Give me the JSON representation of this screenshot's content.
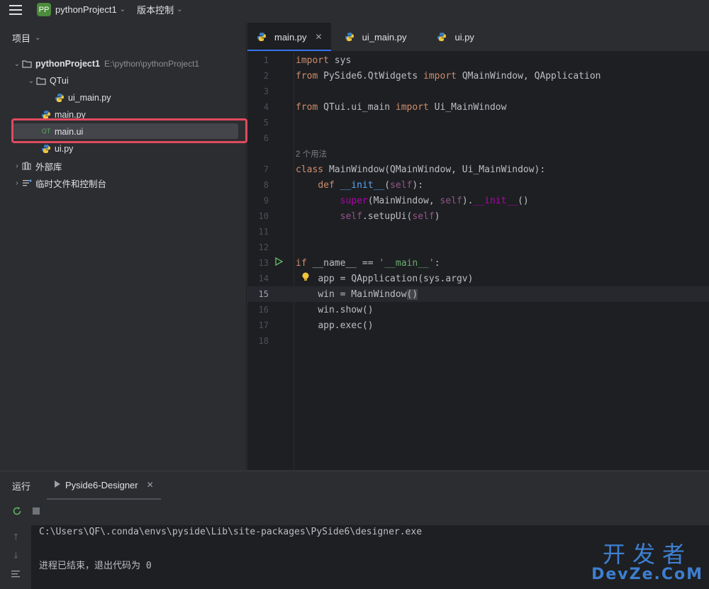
{
  "titlebar": {
    "badge": "PP",
    "project": "pythonProject1",
    "vcs": "版本控制"
  },
  "project_panel": {
    "title": "项目",
    "tree": [
      {
        "label": "pythonProject1",
        "path": "E:\\python\\pythonProject1"
      },
      {
        "label": "QTui"
      },
      {
        "label": "ui_main.py"
      },
      {
        "label": "main.py"
      },
      {
        "label": "main.ui"
      },
      {
        "label": "ui.py"
      },
      {
        "label": "外部库"
      },
      {
        "label": "临时文件和控制台"
      }
    ]
  },
  "editor": {
    "tabs": [
      {
        "label": "main.py",
        "active": true
      },
      {
        "label": "ui_main.py",
        "active": false
      },
      {
        "label": "ui.py",
        "active": false
      }
    ],
    "line_numbers": [
      "1",
      "2",
      "3",
      "4",
      "5",
      "6",
      "7",
      "8",
      "9",
      "10",
      "11",
      "12",
      "13",
      "14",
      "15",
      "16",
      "17",
      "18"
    ],
    "usage_hint": "2 个用法",
    "code": {
      "l1_kw": "import",
      "l1_rest": " sys",
      "l2_kw1": "from",
      "l2_mod": " PySide6.QtWidgets ",
      "l2_kw2": "import",
      "l2_rest": " QMainWindow, QApplication",
      "l4_kw1": "from",
      "l4_mod": " QTui.ui_main ",
      "l4_kw2": "import",
      "l4_rest": " Ui_MainWindow",
      "l7_kw": "class",
      "l7_rest": " MainWindow(QMainWindow, Ui_MainWindow):",
      "l8_kw": "def",
      "l8_fn": "__init__",
      "l8_p1": "(",
      "l8_self": "self",
      "l8_p2": "):",
      "l9_call": "super",
      "l9_a": "(MainWindow, ",
      "l9_self": "self",
      "l9_b": ").",
      "l9_magic": "__init__",
      "l9_c": "()",
      "l10_self": "self",
      "l10_a": ".setupUi(",
      "l10_self2": "self",
      "l10_b": ")",
      "l13_kw": "if",
      "l13_a": " __name__ == ",
      "l13_str": "'__main__'",
      "l13_b": ":",
      "l14": "app = QApplication(sys.argv)",
      "l15_a": "win = MainWindow",
      "l15_paren": "()",
      "l16": "win.show()",
      "l17": "app.exec()"
    }
  },
  "run_panel": {
    "title": "运行",
    "tab": "Pyside6-Designer",
    "output_path": "C:\\Users\\QF\\.conda\\envs\\pyside\\Lib\\site-packages\\PySide6\\designer.exe",
    "exit_message": "进程已结束，退出代码为 0"
  },
  "watermark": {
    "top": "开发者",
    "bottom": "DevZe.CoM"
  },
  "colors": {
    "accent": "#3574f0",
    "highlight": "#e04a5e",
    "keyword": "#cf8e6d",
    "string": "#6aab73"
  }
}
